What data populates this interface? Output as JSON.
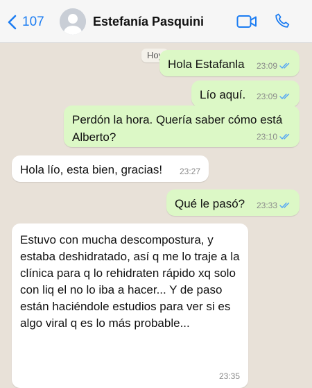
{
  "header": {
    "back_count": "107",
    "contact_name": "Estefanía Pasquini"
  },
  "chat": {
    "day_label": "Hoy",
    "messages": [
      {
        "text": "Hola Estafanla",
        "time": "23:09",
        "direction": "outgoing",
        "read": true
      },
      {
        "text": "Lío aquí.",
        "time": "23:09",
        "direction": "outgoing",
        "read": true
      },
      {
        "text": "Perdón la hora. Quería saber cómo está Alberto?",
        "time": "23:10",
        "direction": "outgoing",
        "read": true
      },
      {
        "text": "Hola lío, esta bien, gracias!",
        "time": "23:27",
        "direction": "incoming"
      },
      {
        "text": "Qué le pasó?",
        "time": "23:33",
        "direction": "outgoing",
        "read": true
      },
      {
        "text": "Estuvo con mucha descompostura, y estaba deshidratado, así q me lo traje a la clínica para q lo rehidraten rápido xq solo con liq el no lo iba a hacer... Y de paso están haciéndole estudios para ver si es algo viral q es lo más probable...",
        "time": "23:35",
        "direction": "incoming"
      }
    ]
  },
  "colors": {
    "accent": "#1b7cf2",
    "outgoing_bubble": "#dcf8c6",
    "incoming_bubble": "#ffffff",
    "read_ticks": "#4fa3f7"
  }
}
